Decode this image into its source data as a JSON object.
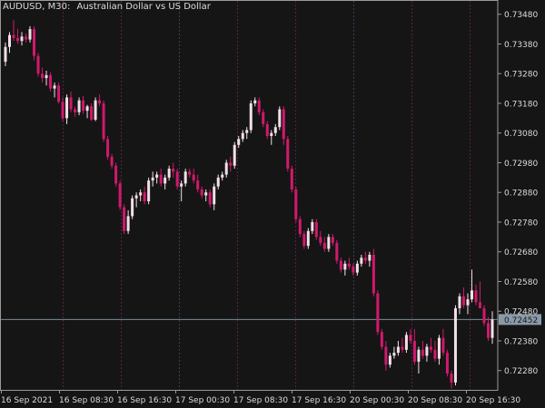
{
  "header": {
    "symbol_period": "AUDUSD, M30:",
    "description": "Australian Dollar vs US Dollar"
  },
  "colors": {
    "background": "#151515",
    "bull_candle": "#f2e0e6",
    "bear_candle": "#d1196c",
    "axis": "#9a9a9a",
    "text": "#dcdcdc",
    "bid_line": "#7b8b96",
    "bid_label_bg": "#8a9aa8",
    "day_separator": "#3c3f58",
    "session_separator": "#55233f"
  },
  "chart_data": {
    "type": "candlestick",
    "title": "AUDUSD, M30:  Australian Dollar vs US Dollar",
    "ylim": [
      0.72215,
      0.73525
    ],
    "y_ticks": [
      "0.73480",
      "0.73380",
      "0.73280",
      "0.73180",
      "0.73080",
      "0.72980",
      "0.72880",
      "0.72780",
      "0.72680",
      "0.72580",
      "0.72480",
      "0.72380",
      "0.72280"
    ],
    "x_ticks": [
      "16 Sep 2021",
      "16 Sep 08:30",
      "16 Sep 16:30",
      "17 Sep 00:30",
      "17 Sep 08:30",
      "17 Sep 16:30",
      "20 Sep 00:30",
      "20 Sep 08:30",
      "20 Sep 16:30"
    ],
    "current_price": "0.72452",
    "candles": [
      [
        0.7332,
        0.73385,
        0.73305,
        0.7337
      ],
      [
        0.7337,
        0.7342,
        0.7335,
        0.7341
      ],
      [
        0.7341,
        0.7346,
        0.7339,
        0.734
      ],
      [
        0.734,
        0.7343,
        0.7338,
        0.7339
      ],
      [
        0.7339,
        0.7342,
        0.73375,
        0.73405
      ],
      [
        0.73405,
        0.73415,
        0.73385,
        0.73395
      ],
      [
        0.73395,
        0.7344,
        0.73385,
        0.7343
      ],
      [
        0.7343,
        0.7344,
        0.73325,
        0.7334
      ],
      [
        0.7334,
        0.7335,
        0.7327,
        0.7328
      ],
      [
        0.7328,
        0.733,
        0.7325,
        0.73265
      ],
      [
        0.73265,
        0.7329,
        0.7324,
        0.73275
      ],
      [
        0.73275,
        0.73285,
        0.7322,
        0.7323
      ],
      [
        0.7323,
        0.7325,
        0.732,
        0.7324
      ],
      [
        0.7324,
        0.7325,
        0.7318,
        0.73185
      ],
      [
        0.73185,
        0.732,
        0.7312,
        0.7313
      ],
      [
        0.7313,
        0.7321,
        0.7311,
        0.732
      ],
      [
        0.732,
        0.7322,
        0.7315,
        0.7316
      ],
      [
        0.7316,
        0.7317,
        0.73135,
        0.7315
      ],
      [
        0.7315,
        0.732,
        0.7314,
        0.7319
      ],
      [
        0.7319,
        0.73205,
        0.73145,
        0.73155
      ],
      [
        0.73155,
        0.73175,
        0.7313,
        0.7317
      ],
      [
        0.7317,
        0.7318,
        0.7312,
        0.73125
      ],
      [
        0.73125,
        0.732,
        0.7312,
        0.7319
      ],
      [
        0.7319,
        0.7321,
        0.7317,
        0.7318
      ],
      [
        0.7318,
        0.7319,
        0.7305,
        0.7306
      ],
      [
        0.7306,
        0.7307,
        0.7299,
        0.73
      ],
      [
        0.73,
        0.7301,
        0.7296,
        0.7297
      ],
      [
        0.7297,
        0.7298,
        0.729,
        0.7291
      ],
      [
        0.7291,
        0.7292,
        0.7282,
        0.7283
      ],
      [
        0.7283,
        0.7284,
        0.7274,
        0.7275
      ],
      [
        0.7275,
        0.7282,
        0.7274,
        0.728
      ],
      [
        0.728,
        0.7287,
        0.7279,
        0.7286
      ],
      [
        0.7286,
        0.7288,
        0.7283,
        0.7287
      ],
      [
        0.7287,
        0.7289,
        0.7285,
        0.7288
      ],
      [
        0.7288,
        0.729,
        0.7284,
        0.7285
      ],
      [
        0.7285,
        0.7293,
        0.7284,
        0.7292
      ],
      [
        0.7292,
        0.7295,
        0.729,
        0.7293
      ],
      [
        0.7293,
        0.7295,
        0.7291,
        0.7294
      ],
      [
        0.7294,
        0.7296,
        0.729,
        0.7291
      ],
      [
        0.7291,
        0.7294,
        0.7289,
        0.7293
      ],
      [
        0.7293,
        0.7297,
        0.7292,
        0.7296
      ],
      [
        0.7296,
        0.7298,
        0.7293,
        0.7295
      ],
      [
        0.7295,
        0.7296,
        0.7289,
        0.729
      ],
      [
        0.729,
        0.7292,
        0.7285,
        0.7291
      ],
      [
        0.7291,
        0.7296,
        0.729,
        0.7295
      ],
      [
        0.7295,
        0.7296,
        0.7293,
        0.7294
      ],
      [
        0.7294,
        0.7296,
        0.7291,
        0.7292
      ],
      [
        0.7292,
        0.7294,
        0.7288,
        0.7289
      ],
      [
        0.7289,
        0.729,
        0.7286,
        0.7287
      ],
      [
        0.7287,
        0.7289,
        0.7285,
        0.7288
      ],
      [
        0.7288,
        0.7289,
        0.7283,
        0.7284
      ],
      [
        0.7284,
        0.7291,
        0.7282,
        0.729
      ],
      [
        0.729,
        0.7294,
        0.7289,
        0.7293
      ],
      [
        0.7293,
        0.7295,
        0.7292,
        0.7294
      ],
      [
        0.7294,
        0.7299,
        0.7293,
        0.7298
      ],
      [
        0.7298,
        0.73,
        0.7295,
        0.7297
      ],
      [
        0.7297,
        0.7305,
        0.7296,
        0.7304
      ],
      [
        0.7304,
        0.7307,
        0.7303,
        0.7306
      ],
      [
        0.7306,
        0.7309,
        0.7305,
        0.7308
      ],
      [
        0.7308,
        0.731,
        0.7306,
        0.7309
      ],
      [
        0.7309,
        0.7319,
        0.7308,
        0.7318
      ],
      [
        0.7318,
        0.732,
        0.7317,
        0.7319
      ],
      [
        0.7319,
        0.732,
        0.7314,
        0.7315
      ],
      [
        0.7315,
        0.7316,
        0.731,
        0.7311
      ],
      [
        0.7311,
        0.7312,
        0.7306,
        0.7307
      ],
      [
        0.7307,
        0.7309,
        0.7304,
        0.7308
      ],
      [
        0.7308,
        0.7311,
        0.7307,
        0.731
      ],
      [
        0.731,
        0.7317,
        0.7309,
        0.7316
      ],
      [
        0.7316,
        0.7317,
        0.7304,
        0.7306
      ],
      [
        0.7306,
        0.7307,
        0.7295,
        0.7296
      ],
      [
        0.7296,
        0.7297,
        0.7288,
        0.7289
      ],
      [
        0.7289,
        0.729,
        0.7278,
        0.7279
      ],
      [
        0.7279,
        0.728,
        0.7273,
        0.7274
      ],
      [
        0.7274,
        0.7275,
        0.7269,
        0.727
      ],
      [
        0.727,
        0.7276,
        0.7269,
        0.7275
      ],
      [
        0.7275,
        0.7279,
        0.7274,
        0.7278
      ],
      [
        0.7278,
        0.7279,
        0.7272,
        0.7273
      ],
      [
        0.7273,
        0.7275,
        0.727,
        0.7271
      ],
      [
        0.7271,
        0.7273,
        0.7268,
        0.7269
      ],
      [
        0.7269,
        0.7274,
        0.7268,
        0.7273
      ],
      [
        0.7273,
        0.7274,
        0.727,
        0.7271
      ],
      [
        0.7271,
        0.7272,
        0.7264,
        0.7265
      ],
      [
        0.7265,
        0.7266,
        0.7261,
        0.7262
      ],
      [
        0.7262,
        0.7265,
        0.726,
        0.7264
      ],
      [
        0.7264,
        0.7266,
        0.7262,
        0.7263
      ],
      [
        0.7263,
        0.7264,
        0.726,
        0.7261
      ],
      [
        0.7261,
        0.7265,
        0.726,
        0.7264
      ],
      [
        0.7264,
        0.7267,
        0.7263,
        0.7266
      ],
      [
        0.7266,
        0.7268,
        0.7264,
        0.7265
      ],
      [
        0.7265,
        0.7268,
        0.7263,
        0.7267
      ],
      [
        0.7267,
        0.7269,
        0.7253,
        0.7254
      ],
      [
        0.7254,
        0.7255,
        0.724,
        0.7241
      ],
      [
        0.7241,
        0.7242,
        0.7235,
        0.7236
      ],
      [
        0.7236,
        0.7238,
        0.7228,
        0.723
      ],
      [
        0.723,
        0.7234,
        0.7229,
        0.7233
      ],
      [
        0.7233,
        0.7236,
        0.7232,
        0.7234
      ],
      [
        0.7234,
        0.7238,
        0.7233,
        0.7236
      ],
      [
        0.7236,
        0.7239,
        0.7234,
        0.7235
      ],
      [
        0.7235,
        0.7241,
        0.7234,
        0.724
      ],
      [
        0.724,
        0.7242,
        0.7237,
        0.7238
      ],
      [
        0.7238,
        0.7242,
        0.723,
        0.7231
      ],
      [
        0.7231,
        0.7236,
        0.7227,
        0.7235
      ],
      [
        0.7235,
        0.7238,
        0.7232,
        0.7233
      ],
      [
        0.7233,
        0.7237,
        0.7231,
        0.7236
      ],
      [
        0.7236,
        0.7239,
        0.7234,
        0.7235
      ],
      [
        0.7235,
        0.7238,
        0.7231,
        0.7232
      ],
      [
        0.7232,
        0.724,
        0.723,
        0.7239
      ],
      [
        0.7239,
        0.7242,
        0.7233,
        0.7234
      ],
      [
        0.7234,
        0.7235,
        0.7226,
        0.7227
      ],
      [
        0.7227,
        0.7228,
        0.7222,
        0.7224
      ],
      [
        0.7224,
        0.725,
        0.7223,
        0.7249
      ],
      [
        0.7249,
        0.7254,
        0.7247,
        0.7253
      ],
      [
        0.7253,
        0.7256,
        0.7249,
        0.725
      ],
      [
        0.725,
        0.7254,
        0.7247,
        0.7252
      ],
      [
        0.7252,
        0.7262,
        0.7251,
        0.7255
      ],
      [
        0.7255,
        0.7257,
        0.725,
        0.7251
      ],
      [
        0.7251,
        0.7258,
        0.7249,
        0.7249
      ],
      [
        0.7249,
        0.725,
        0.7243,
        0.7244
      ],
      [
        0.7244,
        0.7246,
        0.7238,
        0.7239
      ],
      [
        0.7239,
        0.7248,
        0.7237,
        0.72452
      ]
    ]
  }
}
